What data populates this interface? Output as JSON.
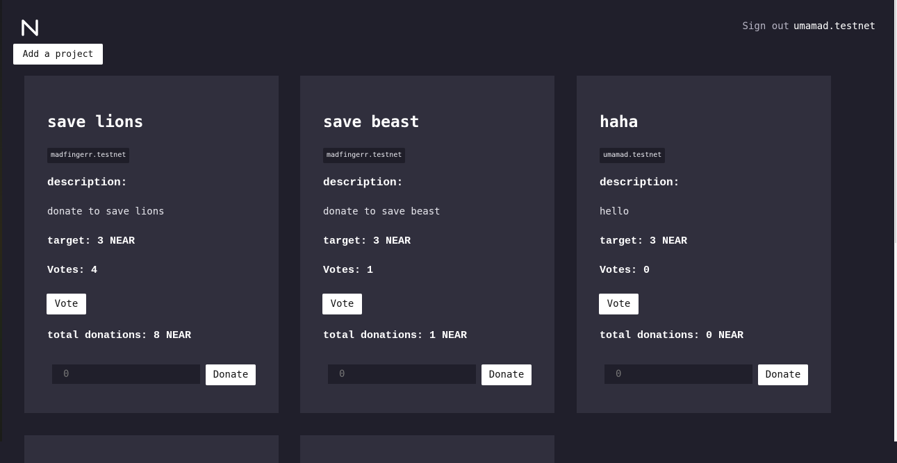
{
  "header": {
    "logo_icon": "near-logo-icon",
    "signout_label": "Sign out",
    "account": "umamad.testnet"
  },
  "actions": {
    "add_project_label": "Add a project"
  },
  "colors": {
    "background": "#201f2b",
    "card": "#302f3d",
    "button": "#ffffff"
  },
  "projects": [
    {
      "title": "save lions",
      "owner": "madfingerr.testnet",
      "description_label": "description:",
      "description": "donate to save lions",
      "target": "target: 3 NEAR",
      "votes": "Votes: 4",
      "vote_label": "Vote",
      "total_donations": "total donations: 8 NEAR",
      "donate_placeholder": "0",
      "donate_label": "Donate"
    },
    {
      "title": "save beast",
      "owner": "madfingerr.testnet",
      "description_label": "description:",
      "description": "donate to save beast",
      "target": "target: 3 NEAR",
      "votes": "Votes: 1",
      "vote_label": "Vote",
      "total_donations": "total donations: 1 NEAR",
      "donate_placeholder": "0",
      "donate_label": "Donate"
    },
    {
      "title": "haha",
      "owner": "umamad.testnet",
      "description_label": "description:",
      "description": "hello",
      "target": "target: 3 NEAR",
      "votes": "Votes: 0",
      "vote_label": "Vote",
      "total_donations": "total donations: 0 NEAR",
      "donate_placeholder": "0",
      "donate_label": "Donate"
    }
  ]
}
